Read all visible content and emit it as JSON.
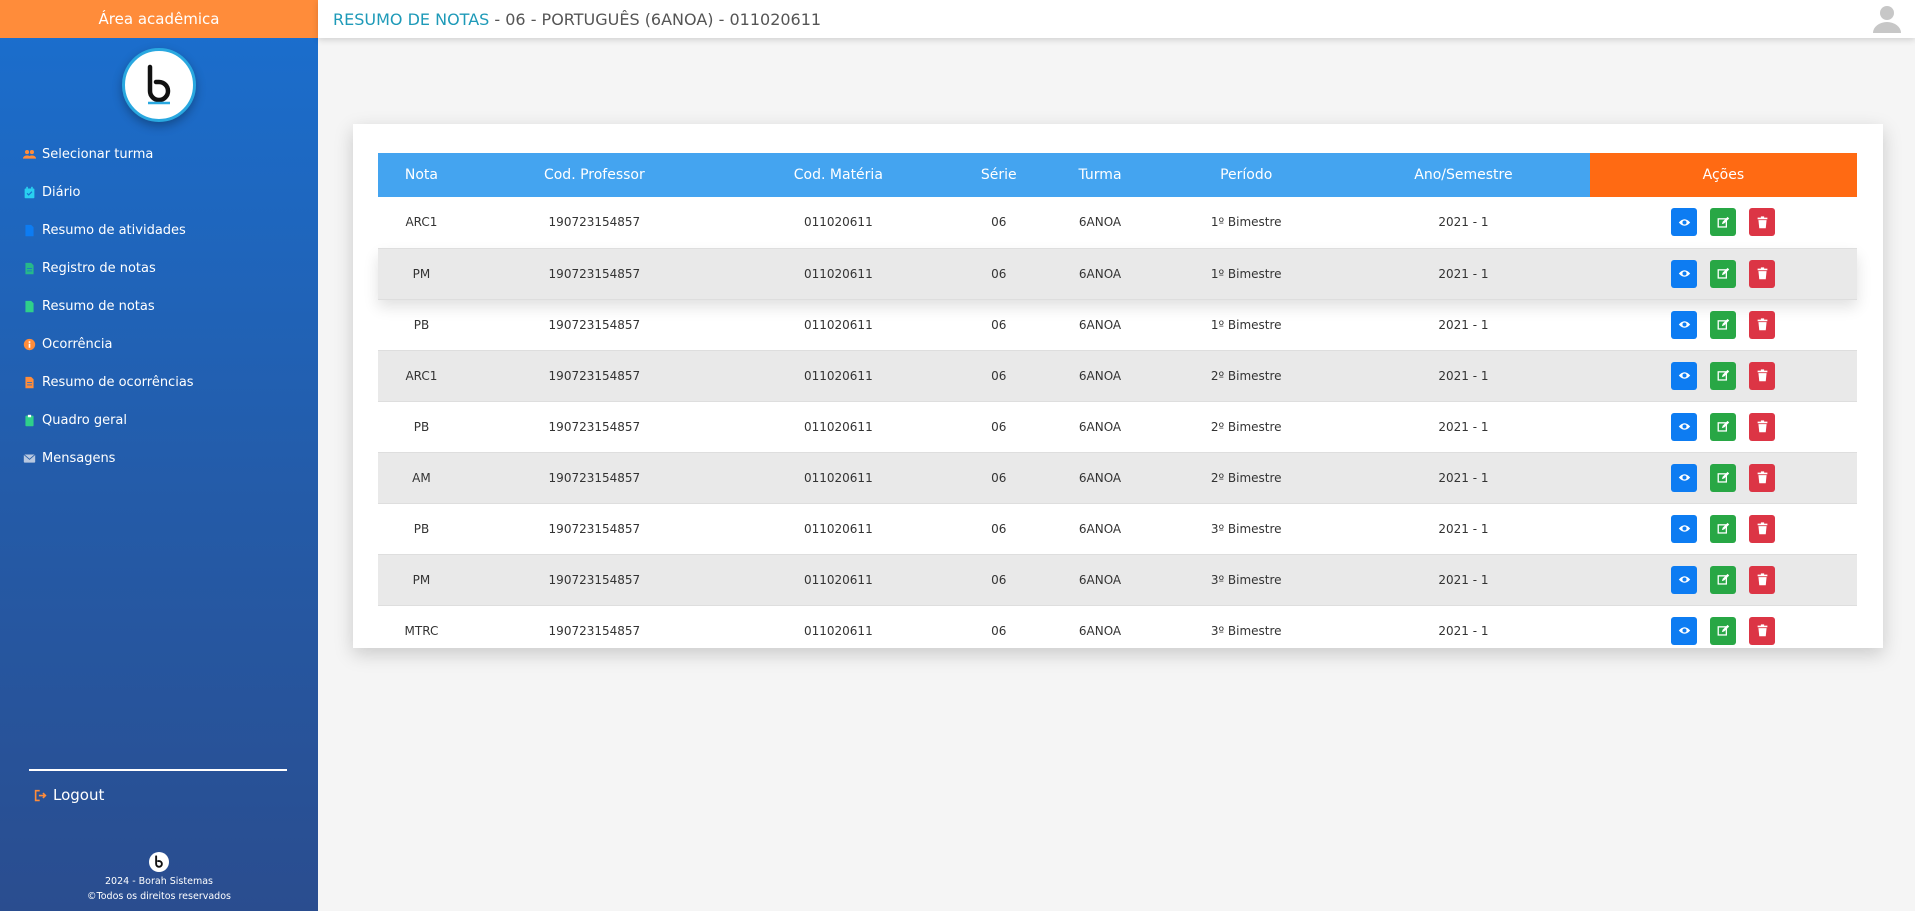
{
  "sidebar": {
    "header": "Área acadêmica",
    "items": [
      {
        "label": "Selecionar turma",
        "icon": "users-icon"
      },
      {
        "label": "Diário",
        "icon": "calendar-check-icon"
      },
      {
        "label": "Resumo de atividades",
        "icon": "file-icon"
      },
      {
        "label": "Registro de notas",
        "icon": "file-text-icon"
      },
      {
        "label": "Resumo de notas",
        "icon": "file-icon"
      },
      {
        "label": "Ocorrência",
        "icon": "info-icon"
      },
      {
        "label": "Resumo de ocorrências",
        "icon": "file-text-icon"
      },
      {
        "label": "Quadro geral",
        "icon": "clipboard-icon"
      },
      {
        "label": "Mensagens",
        "icon": "envelope-icon"
      }
    ],
    "logout": "Logout",
    "footer": {
      "line1": "2024 - Borah Sistemas",
      "line2": "©Todos os direitos reservados"
    }
  },
  "header": {
    "title_accent": "RESUMO DE NOTAS",
    "title_rest": " - 06 - PORTUGUÊS (6ANOA) - 011020611"
  },
  "table": {
    "columns": [
      "Nota",
      "Cod. Professor",
      "Cod. Matéria",
      "Série",
      "Turma",
      "Período",
      "Ano/Semestre",
      "Ações"
    ],
    "rows": [
      [
        "ARC1",
        "190723154857",
        "011020611",
        "06",
        "6ANOA",
        "1º Bimestre",
        "2021 - 1"
      ],
      [
        "PM",
        "190723154857",
        "011020611",
        "06",
        "6ANOA",
        "1º Bimestre",
        "2021 - 1"
      ],
      [
        "PB",
        "190723154857",
        "011020611",
        "06",
        "6ANOA",
        "1º Bimestre",
        "2021 - 1"
      ],
      [
        "ARC1",
        "190723154857",
        "011020611",
        "06",
        "6ANOA",
        "2º Bimestre",
        "2021 - 1"
      ],
      [
        "PB",
        "190723154857",
        "011020611",
        "06",
        "6ANOA",
        "2º Bimestre",
        "2021 - 1"
      ],
      [
        "AM",
        "190723154857",
        "011020611",
        "06",
        "6ANOA",
        "2º Bimestre",
        "2021 - 1"
      ],
      [
        "PB",
        "190723154857",
        "011020611",
        "06",
        "6ANOA",
        "3º Bimestre",
        "2021 - 1"
      ],
      [
        "PM",
        "190723154857",
        "011020611",
        "06",
        "6ANOA",
        "3º Bimestre",
        "2021 - 1"
      ],
      [
        "MTRC",
        "190723154857",
        "011020611",
        "06",
        "6ANOA",
        "3º Bimestre",
        "2021 - 1"
      ]
    ]
  },
  "colors": {
    "sidebar_header": "#ff8c3a",
    "table_header": "#44a4f0",
    "actions_header": "#ff6a13",
    "view": "#0d7cf2",
    "edit": "#28a745",
    "delete": "#dc3545"
  }
}
